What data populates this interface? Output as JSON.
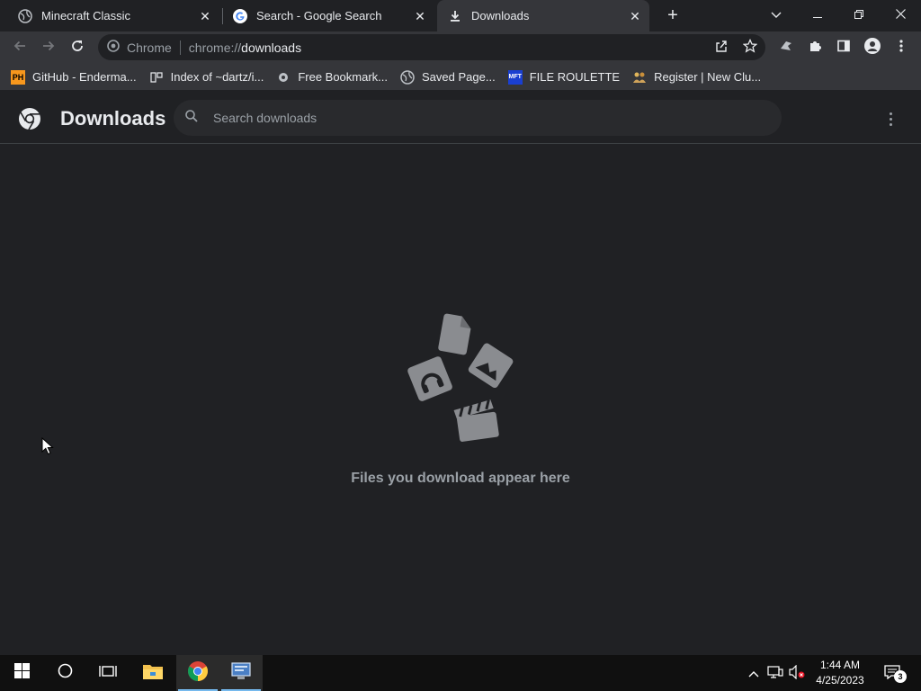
{
  "tabs": [
    {
      "title": "Minecraft Classic",
      "favicon": "globe-icon",
      "active": false
    },
    {
      "title": "Search - Google Search",
      "favicon": "google-g-icon",
      "active": false
    },
    {
      "title": "Downloads",
      "favicon": "download-icon",
      "active": true
    }
  ],
  "window_controls": {
    "minimize": "minimize-icon",
    "restore": "restore-icon",
    "close": "close-icon"
  },
  "omnibox": {
    "site_label": "Chrome",
    "url_scheme": "chrome://",
    "url_host": "downloads"
  },
  "bookmarks": [
    {
      "label": "GitHub - Enderma...",
      "icon": "PH"
    },
    {
      "label": "Index of ~dartz/i...",
      "icon": "index-icon"
    },
    {
      "label": "Free Bookmark...",
      "icon": "gear-globe-icon"
    },
    {
      "label": "Saved Page...",
      "icon": "globe-icon"
    },
    {
      "label": "FILE ROULETTE",
      "icon": "MFT"
    },
    {
      "label": "Register | New Clu...",
      "icon": "people-icon"
    }
  ],
  "page": {
    "title": "Downloads",
    "search_placeholder": "Search downloads",
    "empty_message": "Files you download appear here"
  },
  "taskbar": {
    "time": "1:44 AM",
    "date": "4/25/2023",
    "notification_count": "3"
  },
  "colors": {
    "background": "#202124",
    "toolbar": "#35363a",
    "text": "#e8eaed",
    "muted": "#9aa0a6",
    "taskbar": "#101010",
    "taskbar_accent": "#76b9ed"
  }
}
